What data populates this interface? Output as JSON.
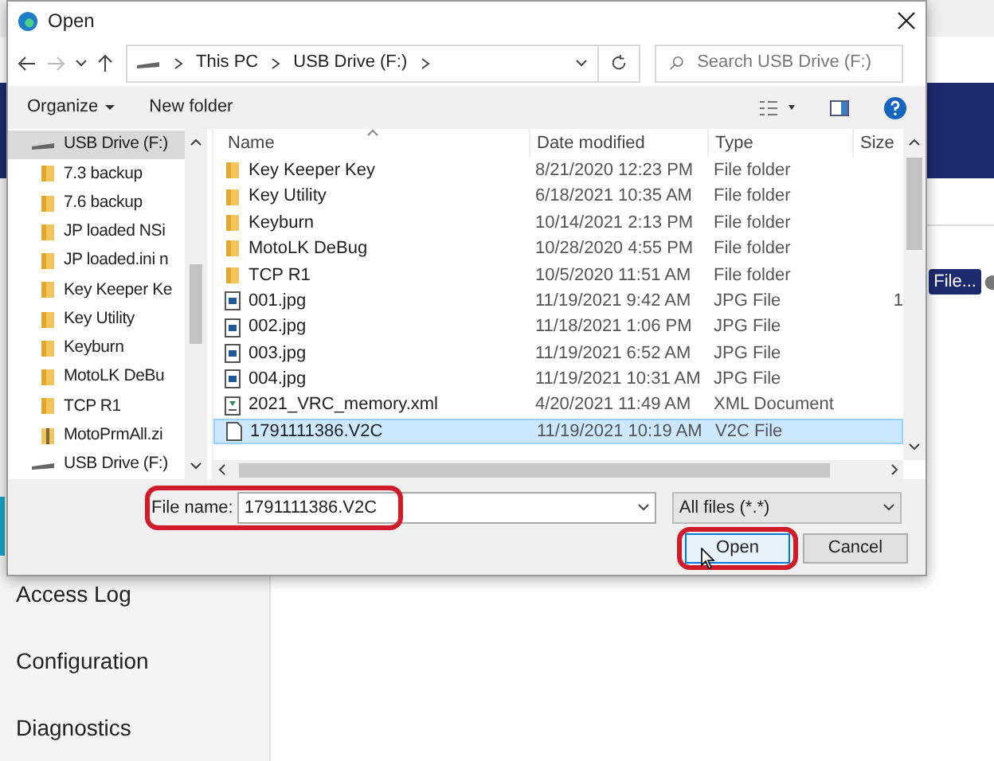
{
  "background_app": {
    "file_button": "File...",
    "sidebar": [
      {
        "label": "Access Log"
      },
      {
        "label": "Configuration"
      },
      {
        "label": "Diagnostics"
      }
    ]
  },
  "dialog": {
    "title": "Open",
    "address": {
      "crumbs": [
        "This PC",
        "USB Drive (F:)"
      ]
    },
    "search": {
      "placeholder": "Search USB Drive (F:)"
    },
    "toolbar": {
      "organize": "Organize",
      "new_folder": "New folder"
    },
    "nav_pane": [
      {
        "label": "USB Drive (F:)",
        "kind": "drive",
        "selected": true
      },
      {
        "label": "7.3 backup",
        "kind": "folder",
        "selected": false
      },
      {
        "label": "7.6 backup",
        "kind": "folder",
        "selected": false
      },
      {
        "label": "JP loaded NSi",
        "kind": "folder",
        "selected": false
      },
      {
        "label": "JP loaded.ini n",
        "kind": "folder",
        "selected": false
      },
      {
        "label": "Key Keeper Ke",
        "kind": "folder",
        "selected": false
      },
      {
        "label": "Key Utility",
        "kind": "folder",
        "selected": false
      },
      {
        "label": "Keyburn",
        "kind": "folder",
        "selected": false
      },
      {
        "label": "MotoLK DeBu",
        "kind": "folder",
        "selected": false
      },
      {
        "label": "TCP R1",
        "kind": "folder",
        "selected": false
      },
      {
        "label": "MotoPrmAll.zi",
        "kind": "zip",
        "selected": false
      },
      {
        "label": "USB Drive (F:)",
        "kind": "drive",
        "selected": false
      }
    ],
    "table": {
      "columns": [
        "Name",
        "Date modified",
        "Type",
        "Size"
      ],
      "rows": [
        {
          "name": "Key Keeper Key",
          "date": "8/21/2020 12:23 PM",
          "type": "File folder",
          "kind": "folder",
          "selected": false
        },
        {
          "name": "Key Utility",
          "date": "6/18/2021 10:35 AM",
          "type": "File folder",
          "kind": "folder",
          "selected": false
        },
        {
          "name": "Keyburn",
          "date": "10/14/2021 2:13 PM",
          "type": "File folder",
          "kind": "folder",
          "selected": false
        },
        {
          "name": "MotoLK DeBug",
          "date": "10/28/2020 4:55 PM",
          "type": "File folder",
          "kind": "folder",
          "selected": false
        },
        {
          "name": "TCP R1",
          "date": "10/5/2020 11:51 AM",
          "type": "File folder",
          "kind": "folder",
          "selected": false
        },
        {
          "name": "001.jpg",
          "date": "11/19/2021 9:42 AM",
          "type": "JPG File",
          "size": "1",
          "kind": "image",
          "selected": false
        },
        {
          "name": "002.jpg",
          "date": "11/18/2021 1:06 PM",
          "type": "JPG File",
          "kind": "image",
          "selected": false
        },
        {
          "name": "003.jpg",
          "date": "11/19/2021 6:52 AM",
          "type": "JPG File",
          "kind": "image",
          "selected": false
        },
        {
          "name": "004.jpg",
          "date": "11/19/2021 10:31 AM",
          "type": "JPG File",
          "kind": "image",
          "selected": false
        },
        {
          "name": "2021_VRC_memory.xml",
          "date": "4/20/2021 11:49 AM",
          "type": "XML Document",
          "kind": "xml",
          "selected": false
        },
        {
          "name": "1791111386.V2C",
          "date": "11/19/2021 10:19 AM",
          "type": "V2C File",
          "kind": "file",
          "selected": true
        }
      ]
    },
    "file_name": {
      "label": "File name:",
      "value": "1791111386.V2C"
    },
    "file_type": {
      "value": "All files (*.*)"
    },
    "buttons": {
      "open": "Open",
      "cancel": "Cancel"
    }
  }
}
